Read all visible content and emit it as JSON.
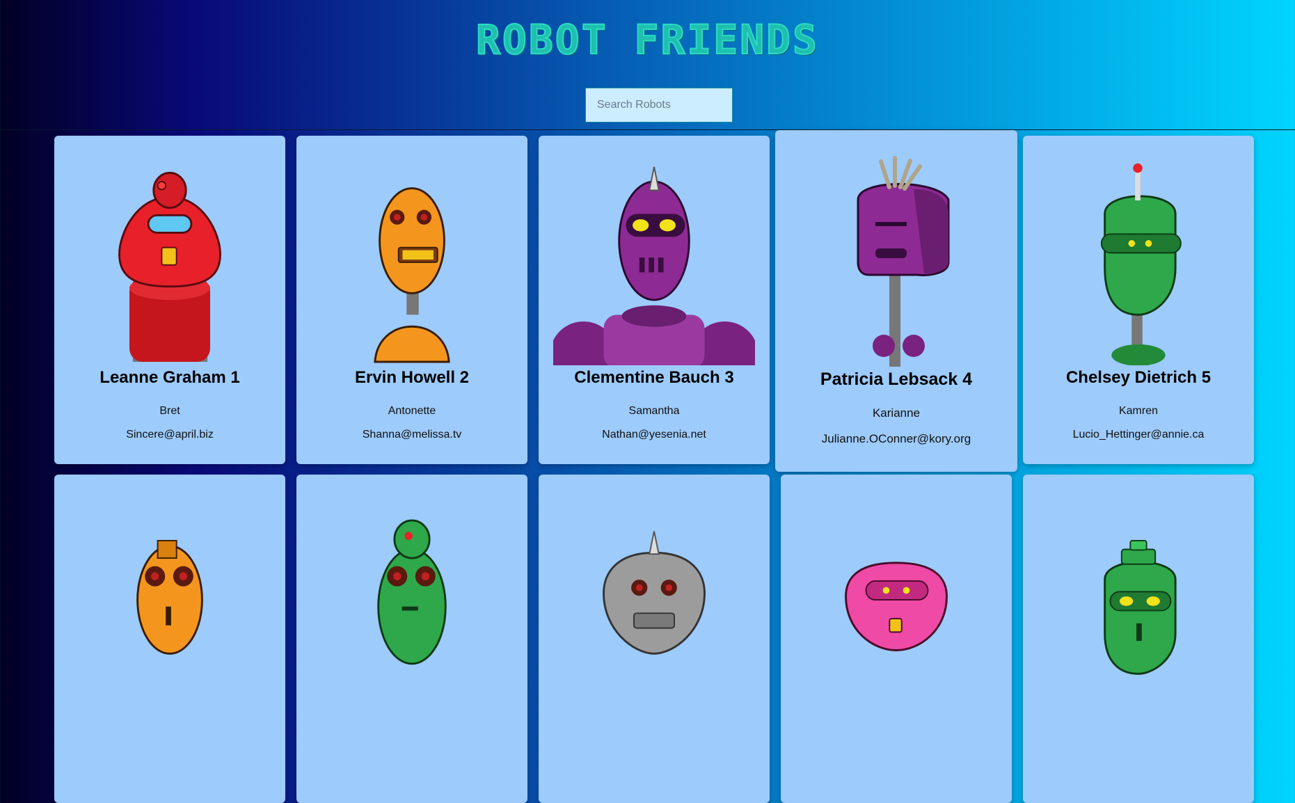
{
  "app": {
    "title": "ROBOT FRIENDS"
  },
  "search": {
    "placeholder": "Search Robots"
  },
  "robots": [
    {
      "name": "Leanne Graham 1",
      "username": "Bret",
      "email": "Sincere@april.biz",
      "color": "#e8202a"
    },
    {
      "name": "Ervin Howell 2",
      "username": "Antonette",
      "email": "Shanna@melissa.tv",
      "color": "#f4961e"
    },
    {
      "name": "Clementine Bauch 3",
      "username": "Samantha",
      "email": "Nathan@yesenia.net",
      "color": "#8e2a94"
    },
    {
      "name": "Patricia Lebsack 4",
      "username": "Karianne",
      "email": "Julianne.OConner@kory.org",
      "color": "#8e2a94"
    },
    {
      "name": "Chelsey Dietrich 5",
      "username": "Kamren",
      "email": "Lucio_Hettinger@annie.ca",
      "color": "#2ea84a"
    },
    {
      "name": "",
      "username": "",
      "email": "",
      "color": "#f4961e"
    },
    {
      "name": "",
      "username": "",
      "email": "",
      "color": "#2ea84a"
    },
    {
      "name": "",
      "username": "",
      "email": "",
      "color": "#9c9c9c"
    },
    {
      "name": "",
      "username": "",
      "email": "",
      "color": "#ee4aa6"
    },
    {
      "name": "",
      "username": "",
      "email": "",
      "color": "#2ea84a"
    }
  ]
}
